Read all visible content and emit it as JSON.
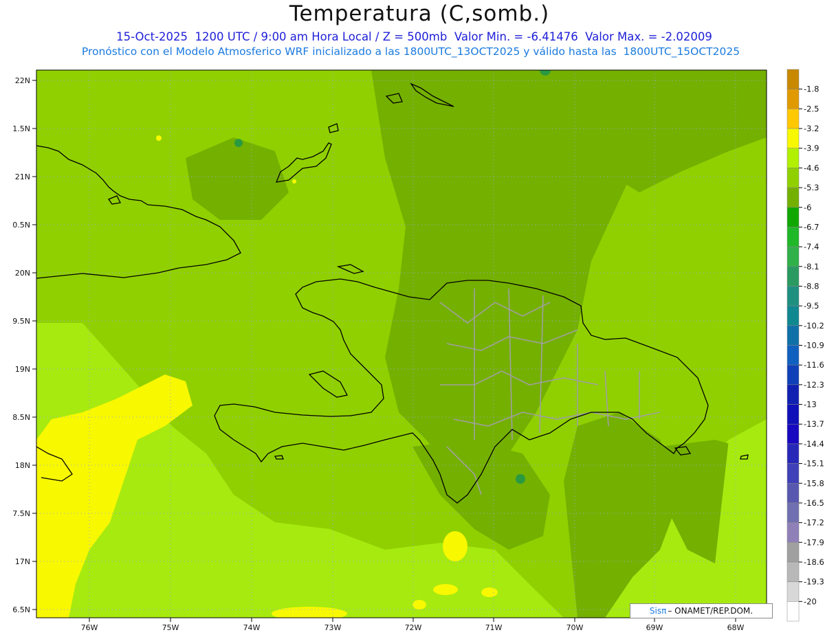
{
  "title": "Temperatura (C,somb.)",
  "subtitle_line1": "15-Oct-2025  1200 UTC / 9:00 am Hora Local / Z = 500mb  Valor Min. = -6.41476  Valor Max. = -2.02009",
  "subtitle_line2": "Pronóstico con el Modelo Atmosferico WRF inicializado a las 1800UTC_13OCT2025 y válido hasta las  1800UTC_15OCT2025",
  "lat_labels": [
    "22N",
    "1.5N",
    "21N",
    "0.5N",
    "20N",
    "9.5N",
    "19N",
    "8.5N",
    "18N",
    "7.5N",
    "17N",
    "6.5N"
  ],
  "lon_labels": [
    "76W",
    "75W",
    "74W",
    "73W",
    "72W",
    "71W",
    "70W",
    "69W",
    "68W"
  ],
  "colorbar": {
    "labels": [
      "-1.8",
      "-2.5",
      "-3.2",
      "-3.9",
      "-4.6",
      "-5.3",
      "-6",
      "-6.7",
      "-7.4",
      "-8.1",
      "-8.8",
      "-9.5",
      "-10.2",
      "-10.9",
      "-11.6",
      "-12.3",
      "-13",
      "-13.7",
      "-14.4",
      "-15.1",
      "-15.8",
      "-16.5",
      "-17.2",
      "-17.9",
      "-18.6",
      "-19.3",
      "-20"
    ],
    "colors": [
      "#c88800",
      "#e09a00",
      "#ffc800",
      "#f8f800",
      "#b0f000",
      "#90d000",
      "#74b000",
      "#10a800",
      "#20b828",
      "#30b048",
      "#2a9a60",
      "#1f9080",
      "#108890",
      "#1070a8",
      "#1060c0",
      "#1040b8",
      "#1020b0",
      "#1010b8",
      "#1808c0",
      "#2828b8",
      "#4040b8",
      "#5858b0",
      "#7070b0",
      "#9080b8",
      "#a0a0a0",
      "#b8b8b8",
      "#d8d8d8",
      "#ffffff"
    ]
  },
  "colors": {
    "sea_light": "#a6ea10",
    "green_mid": "#90d000",
    "green_dark": "#74b000",
    "yellow": "#f8f800",
    "coast": "#000000",
    "provinces": "#a0a0a0",
    "grid": "#9aa8d0"
  },
  "credit": {
    "brand": "Sisπ",
    "rest": "– ONAMET/REP.DOM."
  }
}
